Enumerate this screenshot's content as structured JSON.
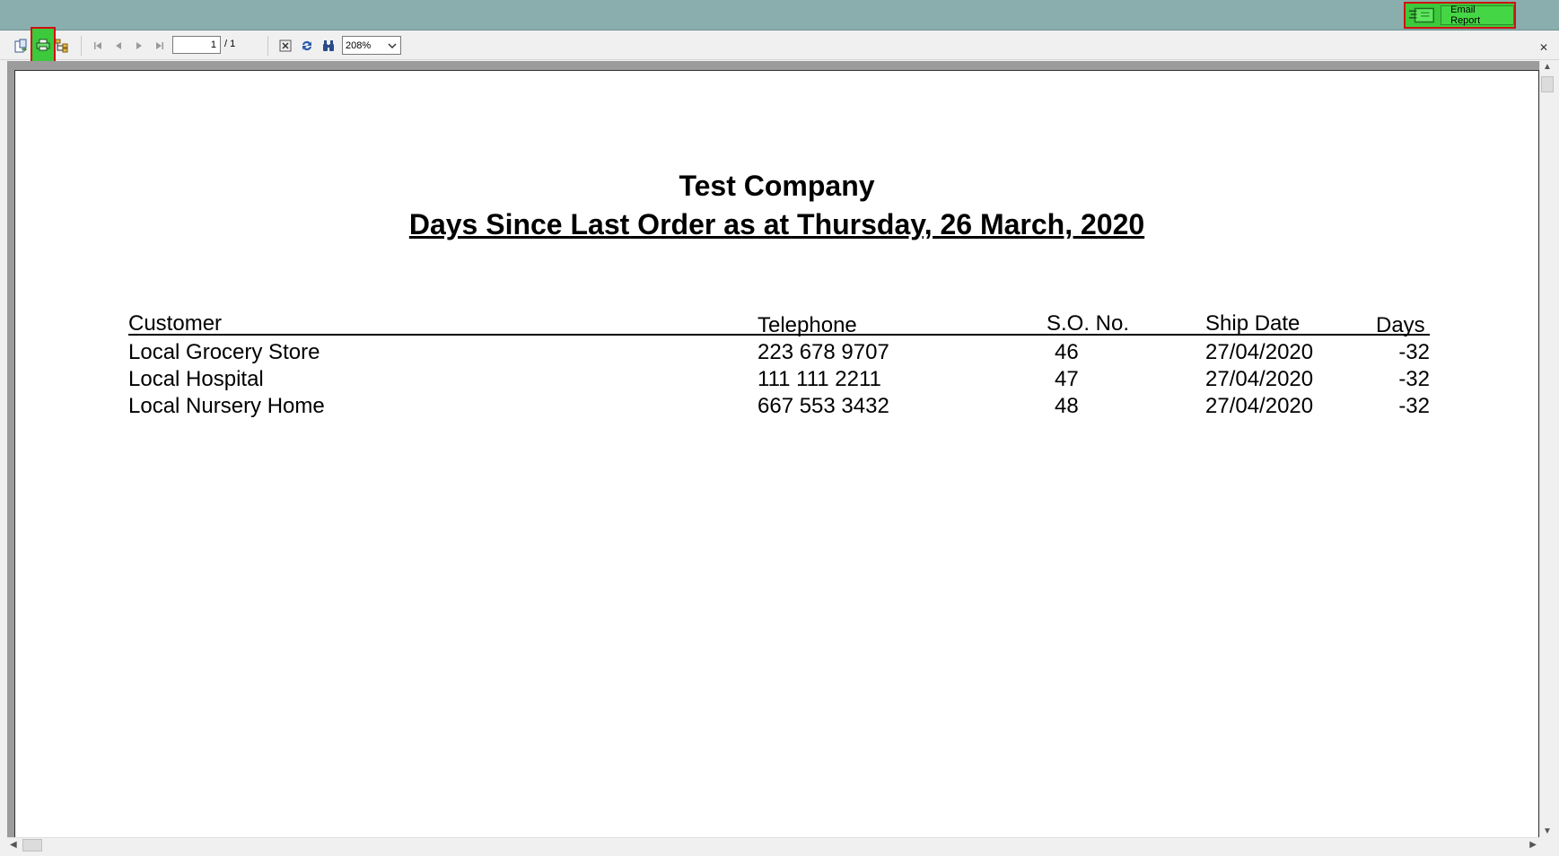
{
  "toolbar": {
    "page_current": "1",
    "page_total": "/ 1",
    "zoom": "208%",
    "close_symbol": "✕",
    "icons": [
      "export-icon",
      "print-icon",
      "group-tree-icon",
      "first-page-icon",
      "previous-page-icon",
      "next-page-icon",
      "last-page-icon",
      "stop-icon",
      "refresh-icon",
      "search-icon"
    ]
  },
  "header": {
    "email_button": "Email Report",
    "accent_color": "#3cc93c",
    "highlight_color": "#d01010"
  },
  "report": {
    "company": "Test Company",
    "title": "Days Since Last Order as at Thursday, 26 March, 2020",
    "columns": {
      "customer": "Customer",
      "telephone": "Telephone",
      "so_no": "S.O. No.",
      "ship_date": "Ship Date",
      "days": "Days"
    },
    "rows": [
      {
        "customer": "Local Grocery Store",
        "telephone": "223 678 9707",
        "so_no": "46",
        "ship_date": "27/04/2020",
        "days": "-32"
      },
      {
        "customer": "Local Hospital",
        "telephone": "111 111 2211",
        "so_no": "47",
        "ship_date": "27/04/2020",
        "days": "-32"
      },
      {
        "customer": "Local Nursery Home",
        "telephone": "667 553 3432",
        "so_no": "48",
        "ship_date": "27/04/2020",
        "days": "-32"
      }
    ]
  }
}
